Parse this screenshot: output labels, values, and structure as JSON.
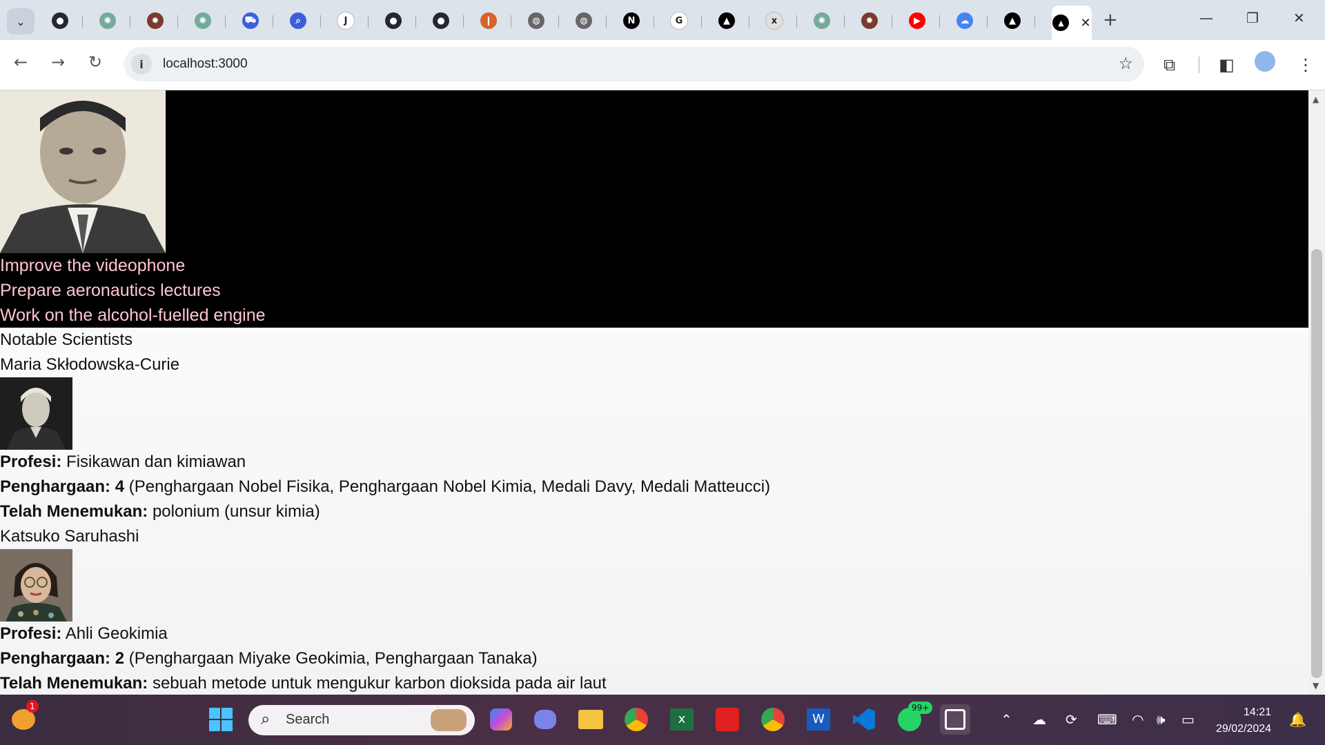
{
  "browser": {
    "url": "localhost:3000",
    "tabs": [
      {
        "icon": "github-icon",
        "color": "#24292f",
        "glyph": "●"
      },
      {
        "icon": "chatgpt-icon",
        "color": "#74aa9c",
        "glyph": "✺"
      },
      {
        "icon": "university-logo-icon",
        "color": "#7a3b2e",
        "glyph": "✹"
      },
      {
        "icon": "chatgpt-icon",
        "color": "#74aa9c",
        "glyph": "✺"
      },
      {
        "icon": "shopping-cart-icon",
        "color": "#3b5fd9",
        "glyph": "⛟"
      },
      {
        "icon": "search-doc-icon",
        "color": "#3b5fd9",
        "glyph": "⌕"
      },
      {
        "icon": "jetbrains-j-icon",
        "color": "#ffffff",
        "glyph": "J"
      },
      {
        "icon": "github-icon",
        "color": "#24292f",
        "glyph": "●"
      },
      {
        "icon": "github-icon",
        "color": "#24292f",
        "glyph": "●"
      },
      {
        "icon": "flame-app-icon",
        "color": "#d8642a",
        "glyph": "❙"
      },
      {
        "icon": "globe-icon",
        "color": "#666666",
        "glyph": "◍"
      },
      {
        "icon": "globe-icon",
        "color": "#666666",
        "glyph": "◍"
      },
      {
        "icon": "nextjs-icon",
        "color": "#000000",
        "glyph": "N"
      },
      {
        "icon": "google-icon",
        "color": "#ffffff",
        "glyph": "G"
      },
      {
        "icon": "vercel-icon",
        "color": "#000000",
        "glyph": "▲"
      },
      {
        "icon": "x-site-icon",
        "color": "#e0e0e0",
        "glyph": "x"
      },
      {
        "icon": "chatgpt-icon",
        "color": "#74aa9c",
        "glyph": "✺"
      },
      {
        "icon": "university-logo-icon",
        "color": "#7a3b2e",
        "glyph": "✹"
      },
      {
        "icon": "youtube-icon",
        "color": "#ff0000",
        "glyph": "▶"
      },
      {
        "icon": "google-cloud-icon",
        "color": "#4285f4",
        "glyph": "☁"
      },
      {
        "icon": "vercel-icon",
        "color": "#000000",
        "glyph": "▲"
      }
    ]
  },
  "page": {
    "todos": [
      "Improve the videophone",
      "Prepare aeronautics lectures",
      "Work on the alcohol-fuelled engine"
    ],
    "heading": "Notable Scientists",
    "scientists": [
      {
        "name": "Maria Skłodowska-Curie",
        "profession_label": "Profesi:",
        "profession": "Fisikawan dan kimiawan",
        "awards_label": "Penghargaan: 4",
        "awards": "(Penghargaan Nobel Fisika, Penghargaan Nobel Kimia, Medali Davy, Medali Matteucci)",
        "discovered_label": "Telah Menemukan:",
        "discovered": "polonium (unsur kimia)"
      },
      {
        "name": "Katsuko Saruhashi",
        "profession_label": "Profesi:",
        "profession": "Ahli Geokimia",
        "awards_label": "Penghargaan: 2",
        "awards": "(Penghargaan Miyake Geokimia, Penghargaan Tanaka)",
        "discovered_label": "Telah Menemukan:",
        "discovered": "sebuah metode untuk mengukur karbon dioksida pada air laut"
      }
    ]
  },
  "taskbar": {
    "search_placeholder": "Search",
    "notification_badge": "1",
    "whatsapp_badge": "99+",
    "time": "14:21",
    "date": "29/02/2024"
  }
}
